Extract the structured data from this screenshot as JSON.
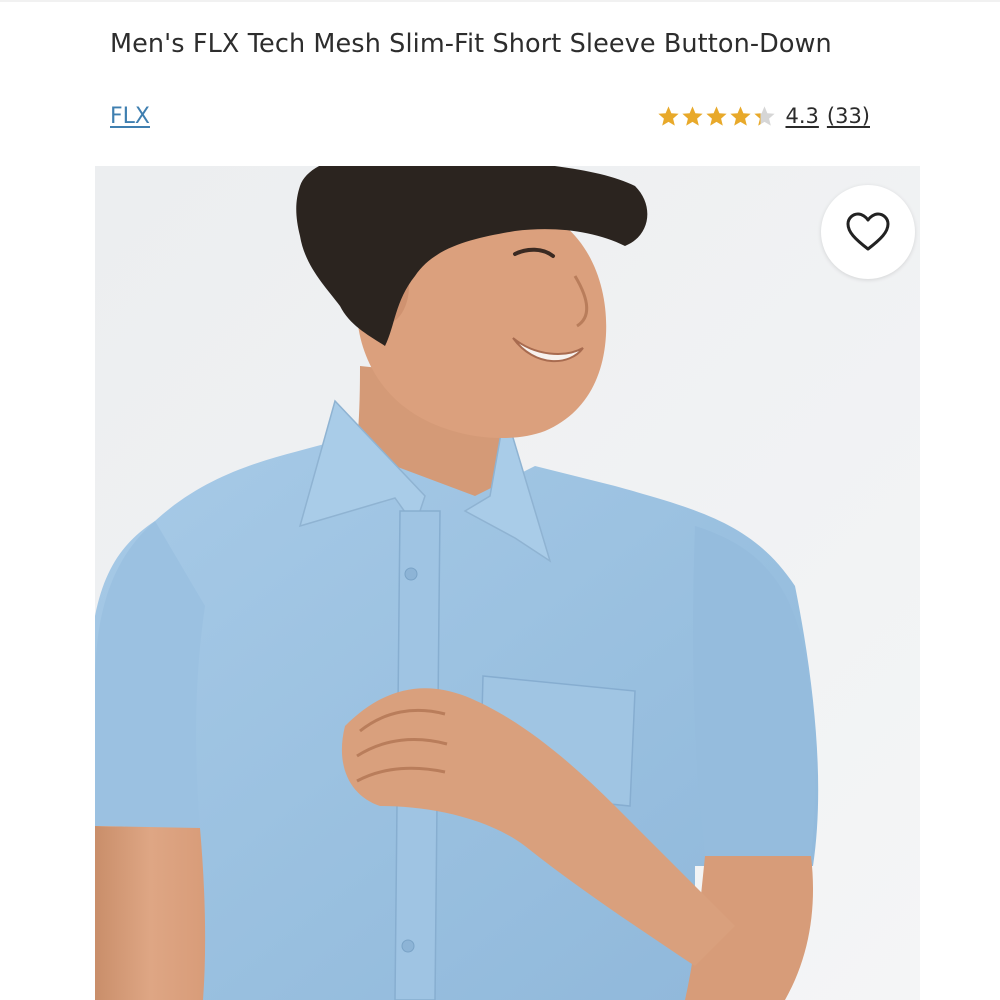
{
  "product": {
    "title": "Men's FLX Tech Mesh Slim-Fit Short Sleeve Button-Down",
    "brand": "FLX",
    "rating": {
      "value": "4.3",
      "count": "(33)",
      "stars_filled": 4.3,
      "stars_max": 5
    },
    "favorite_icon": "heart-outline-icon"
  },
  "colors": {
    "star": "#e8a92a",
    "star_empty": "#d6d6d6",
    "brand_link": "#3f7fb0",
    "shirt": "#9ec3e3"
  }
}
